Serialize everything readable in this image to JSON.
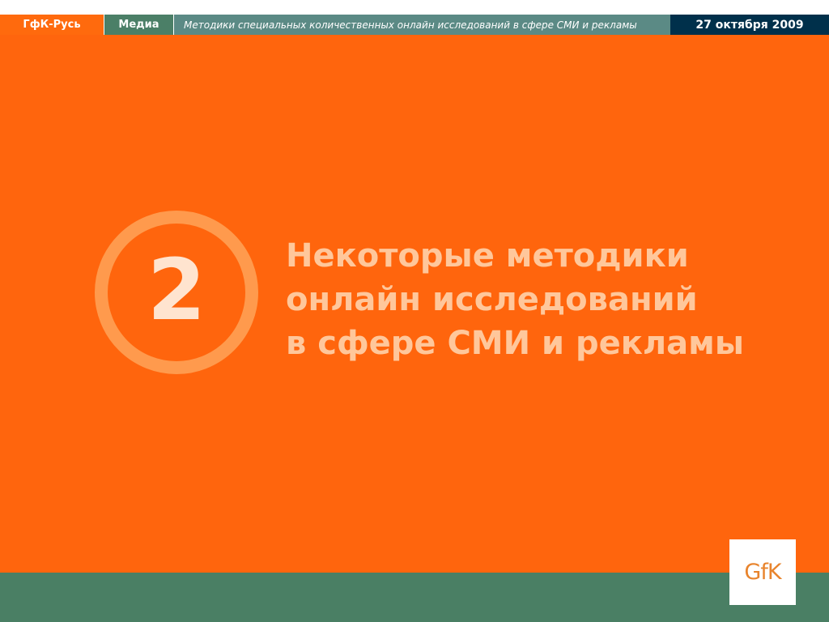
{
  "header": {
    "company": "ГфК-Русь",
    "section": "Медиа",
    "topic": "Методики специальных количественных онлайн исследований в сфере СМИ и рекламы",
    "date": "27 октября 2009"
  },
  "slide": {
    "number": "2",
    "title_lines": [
      "Некоторые методики",
      "онлайн исследований",
      "в сфере СМИ и рекламы"
    ]
  },
  "logo": {
    "text": "GfK"
  },
  "colors": {
    "background": "#ff650d",
    "header_company": "#ff6a0d",
    "header_section": "#4b7f67",
    "header_topic": "#5b8a85",
    "header_date": "#00304b",
    "footer": "#4a7f64",
    "title": "#ffc79b",
    "logo": "#e8842d"
  }
}
